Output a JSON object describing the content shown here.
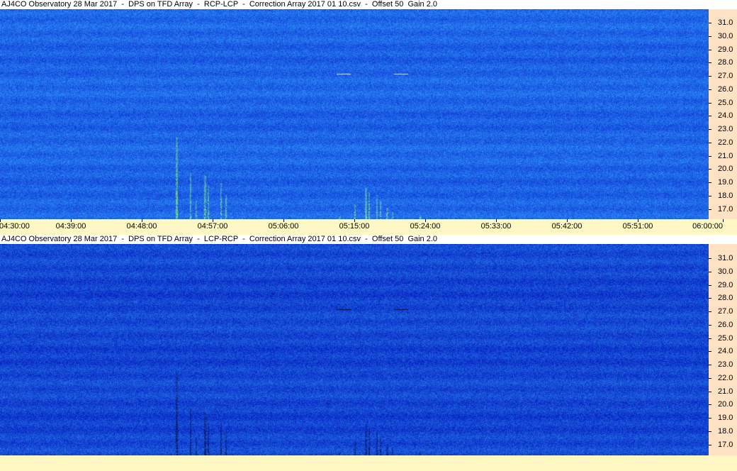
{
  "panels": [
    {
      "id": "top",
      "title": "AJ4CO Observatory 28 Mar 2017  -  DPS on TFD Array  -  RCP-LCP  -  Correction Array 2017 01 10.csv  -  Offset 50  Gain 2.0",
      "mode": "RCP-LCP"
    },
    {
      "id": "bottom",
      "title": "AJ4CO Observatory 28 Mar 2017  -  DPS on TFD Array  -  LCP-RCP  -  Correction Array 2017 01 10.csv  -  Offset 50  Gain 2.0",
      "mode": "LCP-RCP"
    }
  ],
  "freq_axis": {
    "labels": [
      "31.0",
      "30.0",
      "29.0",
      "28.0",
      "27.0",
      "26.0",
      "25.0",
      "24.0",
      "23.0",
      "22.0",
      "21.0",
      "20.0",
      "19.0",
      "18.0",
      "17.0"
    ],
    "range_mhz": [
      16.4,
      31.8
    ]
  },
  "time_axis": {
    "labels": [
      "04:30:00",
      "04:39:00",
      "04:48:00",
      "04:57:00",
      "05:06:00",
      "05:15:00",
      "05:24:00",
      "05:33:00",
      "05:42:00",
      "05:51:00",
      "06:00:00"
    ]
  },
  "colors": {
    "freq_axis_bg": "#ffe1c4",
    "time_axis_bg": "#fff8c4",
    "rcp_lcp_base": "#1e64e6",
    "lcp_rcp_base": "#1446d2",
    "burst_bright": "#9aff80",
    "burst_dark": "#000a3c"
  }
}
